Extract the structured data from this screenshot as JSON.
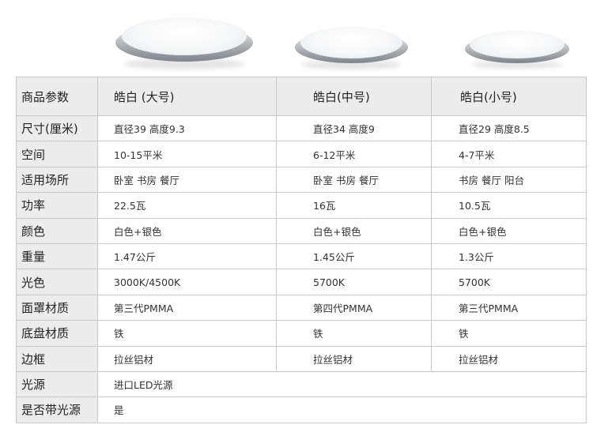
{
  "header": {
    "param_label": "商品参数",
    "models": [
      "皓白 (大号)",
      "皓白(中号)",
      "皓白(小号)"
    ]
  },
  "rows": [
    {
      "label": "尺寸(厘米)",
      "values": [
        "直径39 高度9.3",
        "直径34 高度9",
        "直径29 高度8.5"
      ]
    },
    {
      "label": "空间",
      "values": [
        "10-15平米",
        "6-12平米",
        "4-7平米"
      ]
    },
    {
      "label": "适用场所",
      "values": [
        "卧室 书房 餐厅",
        "卧室 书房 餐厅",
        "书房 餐厅 阳台"
      ]
    },
    {
      "label": "功率",
      "values": [
        "22.5瓦",
        "16瓦",
        "10.5瓦"
      ]
    },
    {
      "label": "颜色",
      "values": [
        "白色+银色",
        "白色+银色",
        "白色+银色"
      ]
    },
    {
      "label": "重量",
      "values": [
        "1.47公斤",
        "1.45公斤",
        "1.3公斤"
      ]
    },
    {
      "label": "光色",
      "values": [
        "3000K/4500K",
        "5700K",
        "5700K"
      ]
    },
    {
      "label": "面罩材质",
      "values": [
        "第三代PMMA",
        "第四代PMMA",
        "第三代PMMA"
      ]
    },
    {
      "label": "底盘材质",
      "values": [
        "铁",
        "铁",
        "铁"
      ]
    },
    {
      "label": "边框",
      "values": [
        "拉丝铝材",
        "拉丝铝材",
        "拉丝铝材"
      ]
    }
  ],
  "shared_rows": [
    {
      "label": "光源",
      "value": "进口LED光源"
    },
    {
      "label": "是否带光源",
      "value": "是"
    }
  ]
}
